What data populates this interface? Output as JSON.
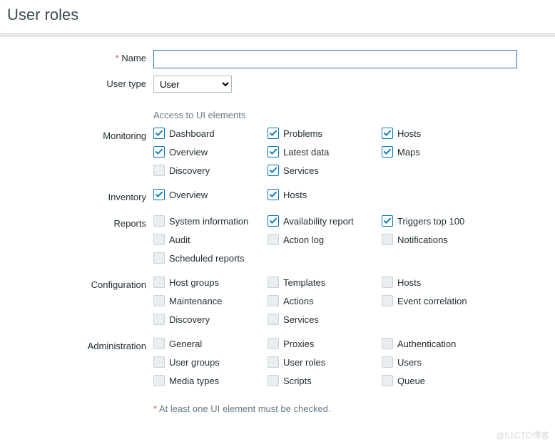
{
  "page_title": "User roles",
  "name_field": {
    "label": "Name",
    "value": ""
  },
  "user_type": {
    "label": "User type",
    "selected": "User"
  },
  "section_title": "Access to UI elements",
  "groups": [
    {
      "label": "Monitoring",
      "items": [
        {
          "label": "Dashboard",
          "checked": true,
          "name": "chk-monitoring-dashboard"
        },
        {
          "label": "Problems",
          "checked": true,
          "name": "chk-monitoring-problems"
        },
        {
          "label": "Hosts",
          "checked": true,
          "name": "chk-monitoring-hosts"
        },
        {
          "label": "Overview",
          "checked": true,
          "name": "chk-monitoring-overview"
        },
        {
          "label": "Latest data",
          "checked": true,
          "name": "chk-monitoring-latest-data"
        },
        {
          "label": "Maps",
          "checked": true,
          "name": "chk-monitoring-maps"
        },
        {
          "label": "Discovery",
          "checked": false,
          "name": "chk-monitoring-discovery"
        },
        {
          "label": "Services",
          "checked": true,
          "name": "chk-monitoring-services"
        }
      ]
    },
    {
      "label": "Inventory",
      "items": [
        {
          "label": "Overview",
          "checked": true,
          "name": "chk-inventory-overview"
        },
        {
          "label": "Hosts",
          "checked": true,
          "name": "chk-inventory-hosts"
        }
      ]
    },
    {
      "label": "Reports",
      "items": [
        {
          "label": "System information",
          "checked": false,
          "name": "chk-reports-system-information"
        },
        {
          "label": "Availability report",
          "checked": true,
          "name": "chk-reports-availability-report"
        },
        {
          "label": "Triggers top 100",
          "checked": true,
          "name": "chk-reports-triggers-top-100"
        },
        {
          "label": "Audit",
          "checked": false,
          "name": "chk-reports-audit"
        },
        {
          "label": "Action log",
          "checked": false,
          "name": "chk-reports-action-log"
        },
        {
          "label": "Notifications",
          "checked": false,
          "name": "chk-reports-notifications"
        },
        {
          "label": "Scheduled reports",
          "checked": false,
          "name": "chk-reports-scheduled-reports"
        }
      ]
    },
    {
      "label": "Configuration",
      "items": [
        {
          "label": "Host groups",
          "checked": false,
          "name": "chk-config-host-groups"
        },
        {
          "label": "Templates",
          "checked": false,
          "name": "chk-config-templates"
        },
        {
          "label": "Hosts",
          "checked": false,
          "name": "chk-config-hosts"
        },
        {
          "label": "Maintenance",
          "checked": false,
          "name": "chk-config-maintenance"
        },
        {
          "label": "Actions",
          "checked": false,
          "name": "chk-config-actions"
        },
        {
          "label": "Event correlation",
          "checked": false,
          "name": "chk-config-event-correlation"
        },
        {
          "label": "Discovery",
          "checked": false,
          "name": "chk-config-discovery"
        },
        {
          "label": "Services",
          "checked": false,
          "name": "chk-config-services"
        }
      ]
    },
    {
      "label": "Administration",
      "items": [
        {
          "label": "General",
          "checked": false,
          "name": "chk-admin-general"
        },
        {
          "label": "Proxies",
          "checked": false,
          "name": "chk-admin-proxies"
        },
        {
          "label": "Authentication",
          "checked": false,
          "name": "chk-admin-authentication"
        },
        {
          "label": "User groups",
          "checked": false,
          "name": "chk-admin-user-groups"
        },
        {
          "label": "User roles",
          "checked": false,
          "name": "chk-admin-user-roles"
        },
        {
          "label": "Users",
          "checked": false,
          "name": "chk-admin-users"
        },
        {
          "label": "Media types",
          "checked": false,
          "name": "chk-admin-media-types"
        },
        {
          "label": "Scripts",
          "checked": false,
          "name": "chk-admin-scripts"
        },
        {
          "label": "Queue",
          "checked": false,
          "name": "chk-admin-queue"
        }
      ]
    }
  ],
  "hint": "At least one UI element must be checked.",
  "watermark": "@51CTO博客"
}
